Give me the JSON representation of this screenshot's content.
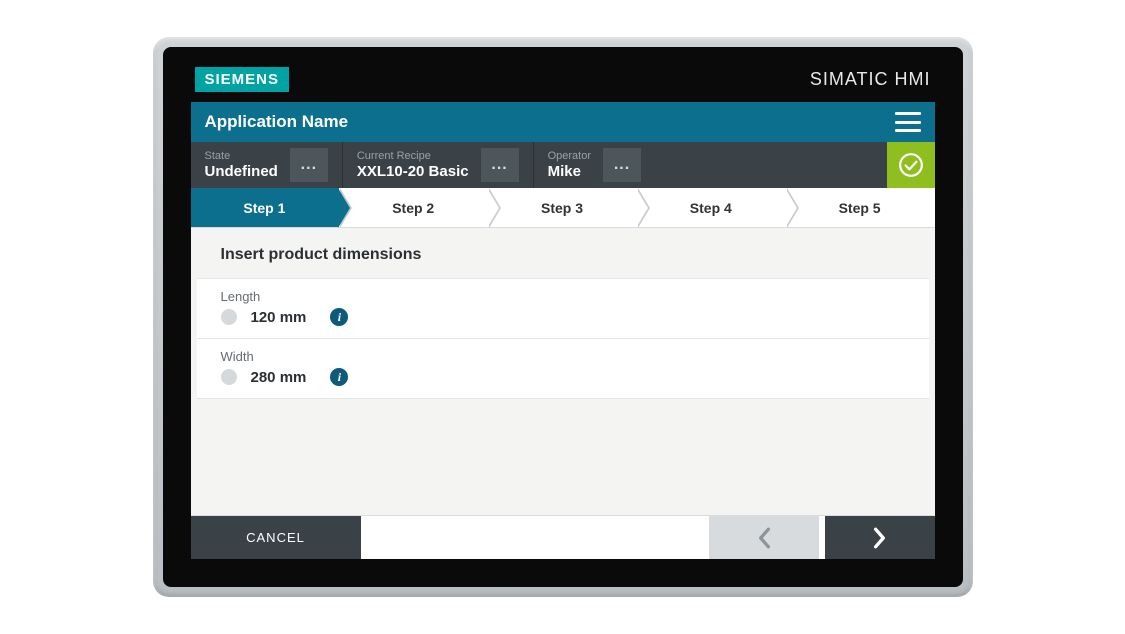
{
  "brand": {
    "logo": "SIEMENS",
    "product": "SIMATIC HMI"
  },
  "titlebar": {
    "app_name": "Application Name"
  },
  "status": {
    "state": {
      "label": "State",
      "value": "Undefined"
    },
    "recipe": {
      "label": "Current Recipe",
      "value": "XXL10-20 Basic"
    },
    "operator": {
      "label": "Operator",
      "value": "Mike"
    },
    "dots": "..."
  },
  "steps": [
    {
      "label": "Step 1",
      "active": true
    },
    {
      "label": "Step 2",
      "active": false
    },
    {
      "label": "Step 3",
      "active": false
    },
    {
      "label": "Step 4",
      "active": false
    },
    {
      "label": "Step 5",
      "active": false
    }
  ],
  "content": {
    "title": "Insert product dimensions",
    "fields": [
      {
        "label": "Length",
        "value": "120 mm"
      },
      {
        "label": "Width",
        "value": "280 mm"
      }
    ]
  },
  "footer": {
    "cancel": "CANCEL"
  }
}
